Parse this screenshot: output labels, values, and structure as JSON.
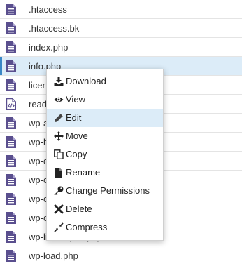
{
  "colors": {
    "file_icon": "#5a4f8e",
    "selected_row": "#dcecf8",
    "menu_hover": "#dcecf8"
  },
  "files": [
    {
      "name": ".htaccess",
      "icon": "document-icon"
    },
    {
      "name": ".htaccess.bk",
      "icon": "document-icon"
    },
    {
      "name": "index.php",
      "icon": "document-icon"
    },
    {
      "name": "info.php",
      "icon": "document-icon",
      "selected": true
    },
    {
      "name": "licer",
      "icon": "document-icon"
    },
    {
      "name": "read",
      "icon": "code-file-icon"
    },
    {
      "name": "wp-a",
      "icon": "document-icon"
    },
    {
      "name": "wp-b",
      "icon": "document-icon"
    },
    {
      "name": "wp-c",
      "icon": "document-icon"
    },
    {
      "name": "wp-c",
      "icon": "document-icon"
    },
    {
      "name": "wp-c",
      "icon": "document-icon"
    },
    {
      "name": "wp-c",
      "icon": "document-icon"
    },
    {
      "name": "wp-links-opml.php",
      "icon": "document-icon"
    },
    {
      "name": "wp-load.php",
      "icon": "document-icon"
    }
  ],
  "context_menu": {
    "items": [
      {
        "label": "Download",
        "icon": "download-icon"
      },
      {
        "label": "View",
        "icon": "eye-icon"
      },
      {
        "label": "Edit",
        "icon": "pencil-icon",
        "hovered": true
      },
      {
        "label": "Move",
        "icon": "move-arrows-icon"
      },
      {
        "label": "Copy",
        "icon": "copy-icon"
      },
      {
        "label": "Rename",
        "icon": "file-icon"
      },
      {
        "label": "Change Permissions",
        "icon": "key-icon"
      },
      {
        "label": "Delete",
        "icon": "x-icon"
      },
      {
        "label": "Compress",
        "icon": "compress-icon"
      }
    ]
  }
}
